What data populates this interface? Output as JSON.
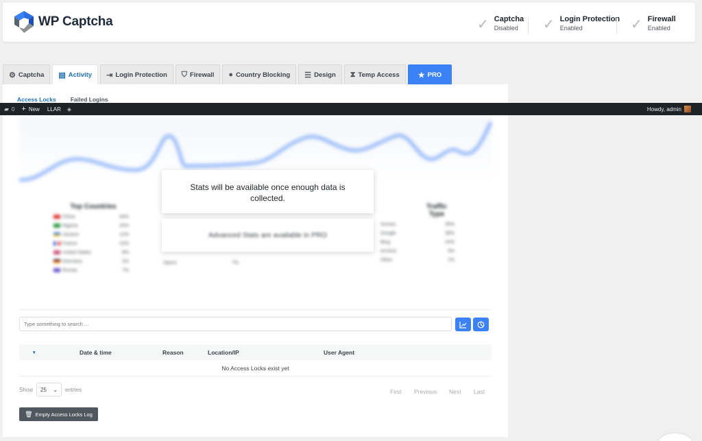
{
  "header": {
    "logo_text": "WP Captcha",
    "statuses": [
      {
        "label": "Captcha",
        "value": "Disabled"
      },
      {
        "label": "Login Protection",
        "value": "Enabled"
      },
      {
        "label": "Firewall",
        "value": "Enabled"
      }
    ]
  },
  "tabs": [
    {
      "label": "Captcha",
      "icon": "captcha-icon"
    },
    {
      "label": "Activity",
      "icon": "document-icon"
    },
    {
      "label": "Login Protection",
      "icon": "login-icon"
    },
    {
      "label": "Firewall",
      "icon": "shield-icon"
    },
    {
      "label": "Country Blocking",
      "icon": "globe-icon"
    },
    {
      "label": "Design",
      "icon": "sliders-icon"
    },
    {
      "label": "Temp Access",
      "icon": "hourglass-icon"
    },
    {
      "label": "PRO",
      "icon": "star-icon"
    }
  ],
  "subtabs": [
    "Access Locks",
    "Failed Logins"
  ],
  "adminbar": {
    "comments_count": "0",
    "new_label": "New",
    "llar_label": "LLAR",
    "howdy": "Howdy, admin"
  },
  "stats": {
    "overlay_message": "Stats will be available once enough data is collected.",
    "pro_message": "Advanced Stats are available in PRO",
    "top_countries_title": "Top Countries",
    "traffic_type_title": "Traffic Type",
    "countries": [
      {
        "name": "China",
        "value": "40%"
      },
      {
        "name": "Nigeria",
        "value": "20%"
      },
      {
        "name": "Ukraine",
        "value": "12%"
      },
      {
        "name": "France",
        "value": "10%"
      },
      {
        "name": "United States",
        "value": "8%"
      },
      {
        "name": "Germany",
        "value": "3%"
      },
      {
        "name": "Russia",
        "value": "7%"
      }
    ],
    "middle_rows": [
      {
        "name": "Opera",
        "value": "7%"
      }
    ],
    "traffic": [
      {
        "name": "Human",
        "value": "35%"
      },
      {
        "name": "Google",
        "value": "38%"
      },
      {
        "name": "Bing",
        "value": "24%"
      },
      {
        "name": "Archive",
        "value": "3%"
      },
      {
        "name": "Other",
        "value": "1%"
      }
    ]
  },
  "search": {
    "placeholder": "Type something to search ..."
  },
  "table": {
    "columns": [
      "Date & time",
      "Reason",
      "Location/IP",
      "User Agent"
    ],
    "empty_message": "No Access Locks exist yet"
  },
  "pagination": {
    "show_label": "Show",
    "entries_value": "25",
    "entries_label": "entries",
    "first": "First",
    "previous": "Previous",
    "next": "Next",
    "last": "Last"
  },
  "empty_log_button": "Empty Access Locks Log",
  "colors": {
    "accent": "#3b82f6",
    "link": "#2271b1",
    "adminbar": "#1d2327"
  }
}
